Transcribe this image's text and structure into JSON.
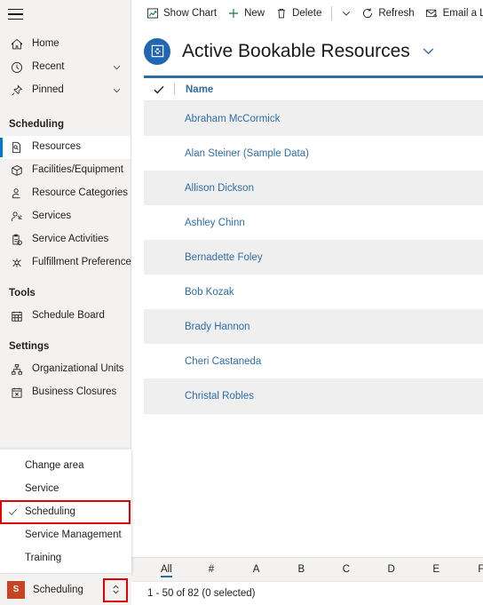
{
  "sidebar": {
    "hamburger_label": "Site map",
    "top_items": [
      {
        "label": "Home",
        "icon": "home-icon",
        "chevron": false
      },
      {
        "label": "Recent",
        "icon": "clock-icon",
        "chevron": true
      },
      {
        "label": "Pinned",
        "icon": "pin-icon",
        "chevron": true
      }
    ],
    "groups": [
      {
        "title": "Scheduling",
        "items": [
          {
            "label": "Resources",
            "icon": "resource-icon",
            "selected": true
          },
          {
            "label": "Facilities/Equipment",
            "icon": "facility-icon",
            "selected": false
          },
          {
            "label": "Resource Categories",
            "icon": "category-icon",
            "selected": false
          },
          {
            "label": "Services",
            "icon": "services-icon",
            "selected": false
          },
          {
            "label": "Service Activities",
            "icon": "activity-icon",
            "selected": false
          },
          {
            "label": "Fulfillment Preferences",
            "icon": "fulfillment-icon",
            "selected": false
          }
        ]
      },
      {
        "title": "Tools",
        "items": [
          {
            "label": "Schedule Board",
            "icon": "calendar-board-icon",
            "selected": false
          }
        ]
      },
      {
        "title": "Settings",
        "items": [
          {
            "label": "Organizational Units",
            "icon": "org-units-icon",
            "selected": false
          },
          {
            "label": "Business Closures",
            "icon": "business-closure-icon",
            "selected": false
          }
        ]
      }
    ]
  },
  "area_switcher": {
    "header": "Change area",
    "options": [
      {
        "label": "Service",
        "checked": false,
        "highlighted": false
      },
      {
        "label": "Scheduling",
        "checked": true,
        "highlighted": true
      },
      {
        "label": "Service Management",
        "checked": false,
        "highlighted": false
      },
      {
        "label": "Training",
        "checked": false,
        "highlighted": false
      }
    ],
    "current_area": "Scheduling",
    "app_initial": "S",
    "expander_icon": "expand-collapse-icon",
    "highlight_color": "#e40000",
    "logo_color": "#c64324"
  },
  "command_bar": {
    "items": [
      {
        "label": "Show Chart",
        "icon": "show-chart-icon",
        "type": "button"
      },
      {
        "label": "New",
        "icon": "plus-icon",
        "type": "button"
      },
      {
        "label": "Delete",
        "icon": "trash-icon",
        "type": "button"
      },
      {
        "label": "",
        "icon": "chevron-down-icon",
        "type": "overflow"
      },
      {
        "label": "Refresh",
        "icon": "refresh-icon",
        "type": "button"
      },
      {
        "label": "Email a Link",
        "icon": "email-link-icon",
        "type": "button"
      }
    ]
  },
  "view": {
    "icon": "bookable-resource-icon",
    "icon_color": "#2266b1",
    "title": "Active Bookable Resources",
    "selector_icon": "chevron-down-icon"
  },
  "grid": {
    "accent_color": "#2e6da4",
    "select_all_icon": "checkmark-icon",
    "columns": [
      "Name"
    ],
    "rows": [
      {
        "name": "Abraham McCormick"
      },
      {
        "name": "Alan Steiner (Sample Data)"
      },
      {
        "name": "Allison Dickson"
      },
      {
        "name": "Ashley Chinn"
      },
      {
        "name": "Bernadette Foley"
      },
      {
        "name": "Bob Kozak"
      },
      {
        "name": "Brady Hannon"
      },
      {
        "name": "Cheri Castaneda"
      },
      {
        "name": "Christal Robles"
      }
    ]
  },
  "alpha_index": {
    "items": [
      "All",
      "#",
      "A",
      "B",
      "C",
      "D",
      "E",
      "F"
    ],
    "active": "All"
  },
  "status": {
    "text": "1 - 50 of 82 (0 selected)"
  }
}
